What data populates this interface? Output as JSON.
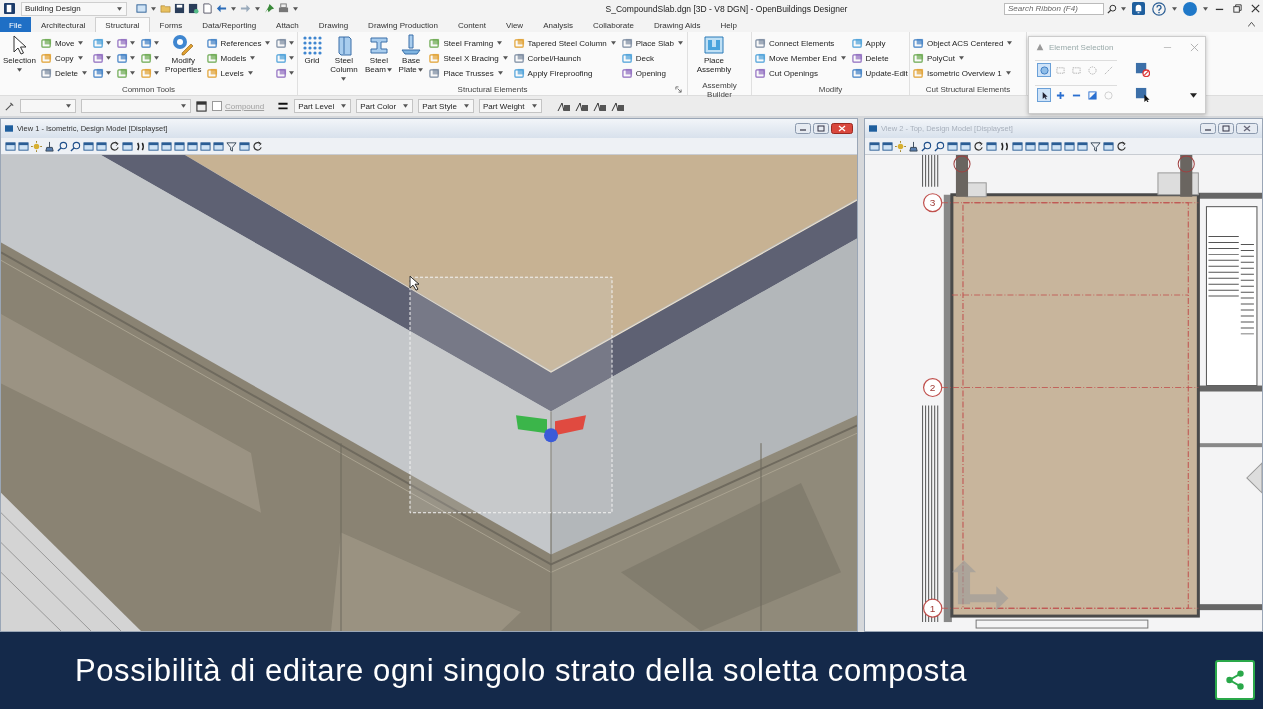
{
  "title_bar": {
    "workflow": "Building Design",
    "title": "S_CompoundSlab.dgn [3D - V8 DGN] - OpenBuildings Designer",
    "search": {
      "placeholder": "Search Ribbon (F4)"
    }
  },
  "tabs": [
    {
      "label": "File",
      "kind": "file",
      "selected": false
    },
    {
      "label": "Architectural",
      "kind": "tab",
      "selected": false
    },
    {
      "label": "Structural",
      "kind": "tab",
      "selected": true
    },
    {
      "label": "Forms",
      "kind": "tab",
      "selected": false
    },
    {
      "label": "Data/Reporting",
      "kind": "tab",
      "selected": false
    },
    {
      "label": "Attach",
      "kind": "tab",
      "selected": false
    },
    {
      "label": "Drawing",
      "kind": "tab",
      "selected": false
    },
    {
      "label": "Drawing Production",
      "kind": "tab",
      "selected": false
    },
    {
      "label": "Content",
      "kind": "tab",
      "selected": false
    },
    {
      "label": "View",
      "kind": "tab",
      "selected": false
    },
    {
      "label": "Analysis",
      "kind": "tab",
      "selected": false
    },
    {
      "label": "Collaborate",
      "kind": "tab",
      "selected": false
    },
    {
      "label": "Drawing Aids",
      "kind": "tab",
      "selected": false
    },
    {
      "label": "Help",
      "kind": "tab",
      "selected": false
    }
  ],
  "ribbon_groups": [
    {
      "label": "Common Tools",
      "launcher": false,
      "columns": [
        {
          "kind": "large",
          "label": "Selection",
          "dropdown": true
        },
        {
          "kind": "stack",
          "items": [
            {
              "label": "Move",
              "dropdown": true
            },
            {
              "label": "Copy",
              "dropdown": true
            },
            {
              "label": "Delete",
              "dropdown": true
            }
          ]
        },
        {
          "kind": "icons"
        },
        {
          "kind": "icons"
        },
        {
          "kind": "icons"
        },
        {
          "kind": "large",
          "label": "Modify Properties",
          "dropdown": false
        },
        {
          "kind": "stack",
          "items": [
            {
              "label": "References",
              "dropdown": true
            },
            {
              "label": "Models",
              "dropdown": true
            },
            {
              "label": "Levels",
              "dropdown": true
            }
          ]
        },
        {
          "kind": "icons"
        }
      ]
    },
    {
      "label": "Structural Elements",
      "launcher": true,
      "columns": [
        {
          "kind": "large",
          "label": "Grid",
          "dropdown": false
        },
        {
          "kind": "large",
          "label": "Steel Column",
          "dropdown": true
        },
        {
          "kind": "large",
          "label": "Steel Beam",
          "dropdown": true
        },
        {
          "kind": "large",
          "label": "Base Plate",
          "dropdown": true
        },
        {
          "kind": "stack",
          "items": [
            {
              "label": "Steel Framing",
              "dropdown": true
            },
            {
              "label": "Steel X Bracing",
              "dropdown": true
            },
            {
              "label": "Place Trusses",
              "dropdown": true
            }
          ]
        },
        {
          "kind": "stack",
          "items": [
            {
              "label": "Tapered Steel Column",
              "dropdown": true
            },
            {
              "label": "Corbel/Haunch",
              "dropdown": false
            },
            {
              "label": "Apply Fireproofing",
              "dropdown": false
            }
          ]
        },
        {
          "kind": "stack",
          "items": [
            {
              "label": "Place Slab",
              "dropdown": true
            },
            {
              "label": "Deck",
              "dropdown": false
            },
            {
              "label": "Opening",
              "dropdown": false
            }
          ]
        }
      ]
    },
    {
      "label": "Assembly Builder",
      "launcher": false,
      "columns": [
        {
          "kind": "large",
          "label": "Place Assembly",
          "dropdown": false
        }
      ]
    },
    {
      "label": "Modify",
      "launcher": false,
      "columns": [
        {
          "kind": "stack",
          "items": [
            {
              "label": "Connect Elements",
              "dropdown": false
            },
            {
              "label": "Move Member End",
              "dropdown": true
            },
            {
              "label": "Cut Openings",
              "dropdown": false
            }
          ]
        },
        {
          "kind": "stack",
          "items": [
            {
              "label": "Apply",
              "dropdown": false
            },
            {
              "label": "Delete",
              "dropdown": false
            },
            {
              "label": "Update-Edit",
              "dropdown": false
            }
          ]
        }
      ]
    },
    {
      "label": "Cut Structural Elements",
      "launcher": false,
      "columns": [
        {
          "kind": "stack",
          "items": [
            {
              "label": "Object ACS Centered",
              "dropdown": true
            },
            {
              "label": "PolyCut",
              "dropdown": true
            },
            {
              "label": "Isometric Overview 1",
              "dropdown": true
            }
          ]
        }
      ]
    }
  ],
  "element_selection": {
    "title": "Element Selection",
    "methods": [
      {
        "selected": true
      },
      {
        "selected": false
      },
      {
        "selected": false
      },
      {
        "selected": false
      },
      {
        "selected": false
      }
    ],
    "modes": [
      {
        "selected": true
      },
      {
        "selected": false
      },
      {
        "selected": false
      },
      {
        "selected": false
      },
      {
        "selected": false
      }
    ]
  },
  "attribute_bar": {
    "compound": {
      "label": "Compound",
      "checked": false,
      "disabled": true
    },
    "part_fields": [
      {
        "value": "Part Level"
      },
      {
        "value": "Part Color"
      },
      {
        "value": "Part Style"
      },
      {
        "value": "Part Weight"
      }
    ]
  },
  "views": [
    {
      "kind": "isometric",
      "title": "View 1 - Isometric, Design Model [Displayset]",
      "active": true
    },
    {
      "kind": "top",
      "title": "View 2 - Top, Design Model [Displayset]",
      "active": false,
      "grid_bubbles": [
        "3",
        "2",
        "1"
      ]
    }
  ],
  "caption": "Possibilità di editare ogni singolo strato della soletta composta"
}
